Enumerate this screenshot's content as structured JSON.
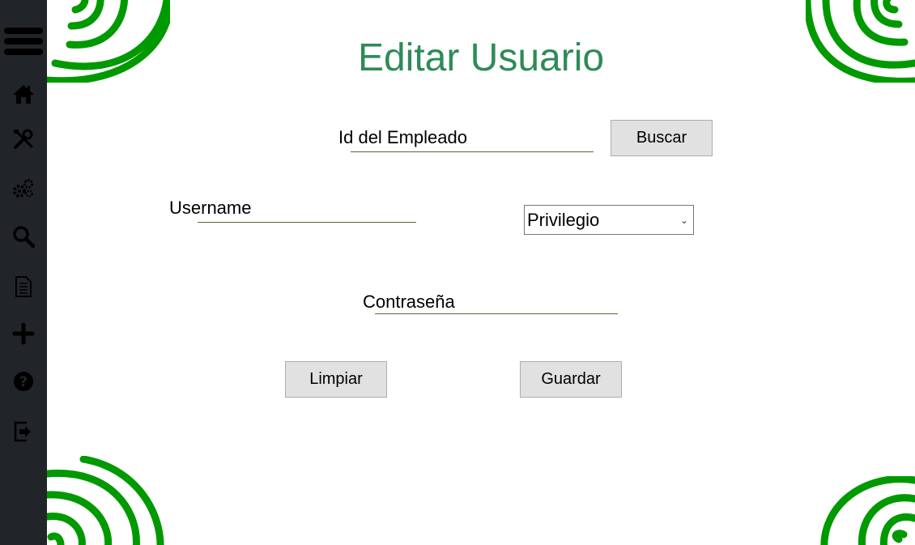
{
  "page": {
    "title": "Editar Usuario"
  },
  "sidebar": {
    "items": [
      {
        "icon": "menu-icon"
      },
      {
        "icon": "home-icon"
      },
      {
        "icon": "tools-icon"
      },
      {
        "icon": "gears-icon"
      },
      {
        "icon": "search-icon"
      },
      {
        "icon": "document-icon"
      },
      {
        "icon": "plus-icon"
      },
      {
        "icon": "help-icon"
      },
      {
        "icon": "logout-icon"
      }
    ]
  },
  "form": {
    "employee_id_label": "Id del Empleado",
    "employee_id_value": "",
    "search_button": "Buscar",
    "username_label": "Username",
    "username_value": "",
    "privilege_selected": "Privilegio",
    "password_label": "Contraseña",
    "password_value": "",
    "clear_button": "Limpiar",
    "save_button": "Guardar"
  },
  "colors": {
    "sidebar_bg": "#212529",
    "title": "#2e8b57",
    "spiral": "#009900",
    "underline": "#556b2f",
    "button_bg": "#e1e1e1"
  }
}
